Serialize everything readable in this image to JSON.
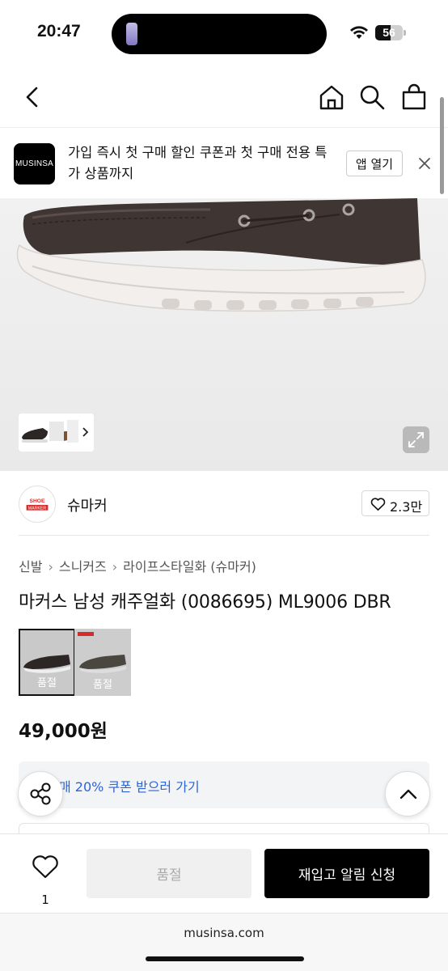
{
  "status": {
    "time": "20:47",
    "battery_pct": "56",
    "battery_level": 0.56
  },
  "banner": {
    "logo": "MUSINSA",
    "text": "가입 즉시 첫 구매 할인 쿠폰과 첫 구매 전용 특가 상품까지",
    "open_label": "앱 열기"
  },
  "brand": {
    "name": "슈마커",
    "logo_text_1": "SHOE",
    "logo_text_2": "MARKER",
    "likes": "2.3만"
  },
  "breadcrumb": [
    "신발",
    "스니커즈",
    "라이프스타일화 (슈마커)"
  ],
  "product": {
    "title": "마커스 남성 캐주얼화 (0086695) ML9006 DBR",
    "price": "49,000원",
    "options": [
      {
        "label": "품절"
      },
      {
        "label": "품절"
      }
    ]
  },
  "coupon": {
    "text": "매 20% 쿠폰 받으러 가기"
  },
  "bottom": {
    "wish_count": "1",
    "soldout_label": "품절",
    "restock_label": "재입고 알림 신청"
  },
  "urlbar": {
    "url": "musinsa.com"
  },
  "colors": {
    "accent_blue": "#2b63d9",
    "shoe_brown": "#3f3533",
    "sole": "#f2efec"
  },
  "icons": [
    "chevron-left-icon",
    "home-icon",
    "search-icon",
    "shopping-bag-icon",
    "close-icon",
    "expand-icon",
    "heart-icon",
    "share-icon",
    "chevron-up-icon",
    "chevron-right-icon",
    "wifi-icon"
  ]
}
